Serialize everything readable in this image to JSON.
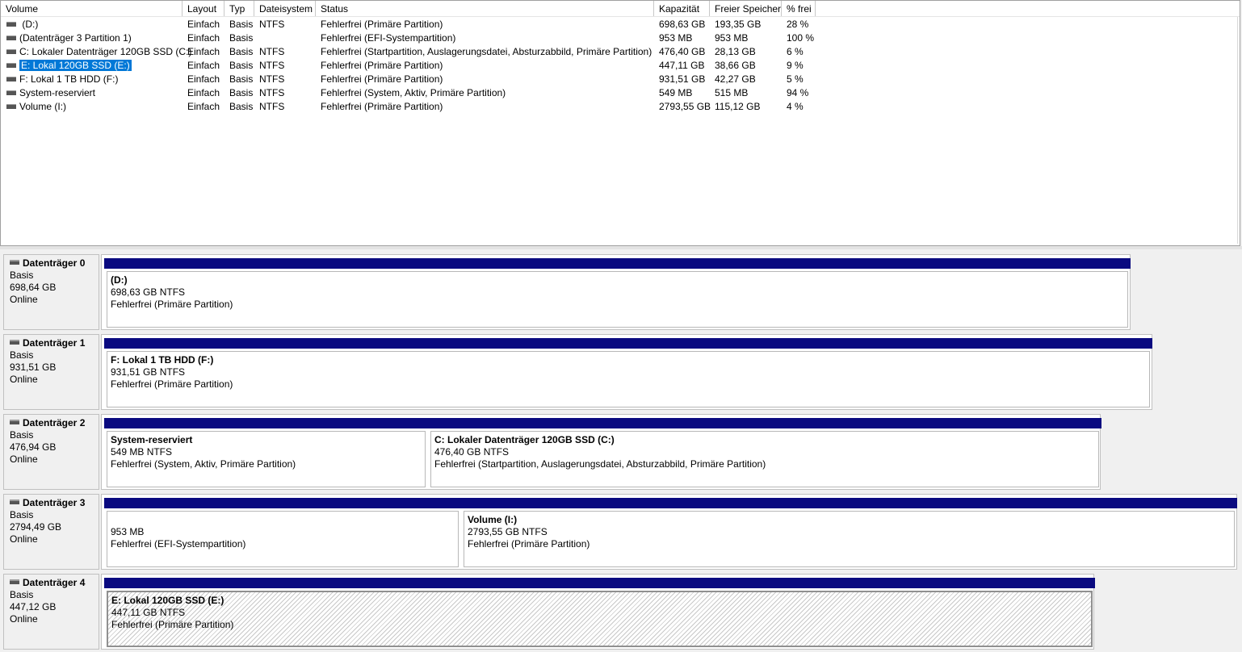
{
  "columns": [
    "Volume",
    "Layout",
    "Typ",
    "Dateisystem",
    "Status",
    "Kapazität",
    "Freier Speicher",
    "% frei"
  ],
  "volumes": [
    {
      "name": " (D:)",
      "layout": "Einfach",
      "typ": "Basis",
      "fs": "NTFS",
      "status": "Fehlerfrei (Primäre Partition)",
      "kap": "698,63 GB",
      "frei": "193,35 GB",
      "pct": "28 %"
    },
    {
      "name": "(Datenträger 3 Partition 1)",
      "layout": "Einfach",
      "typ": "Basis",
      "fs": "",
      "status": "Fehlerfrei (EFI-Systempartition)",
      "kap": "953 MB",
      "frei": "953 MB",
      "pct": "100 %"
    },
    {
      "name": "C: Lokaler Datenträger 120GB SSD (C:)",
      "layout": "Einfach",
      "typ": "Basis",
      "fs": "NTFS",
      "status": "Fehlerfrei (Startpartition, Auslagerungsdatei, Absturzabbild, Primäre Partition)",
      "kap": "476,40 GB",
      "frei": "28,13 GB",
      "pct": "6 %"
    },
    {
      "name": "E: Lokal 120GB SSD (E:)",
      "layout": "Einfach",
      "typ": "Basis",
      "fs": "NTFS",
      "status": "Fehlerfrei (Primäre Partition)",
      "kap": "447,11 GB",
      "frei": "38,66 GB",
      "pct": "9 %"
    },
    {
      "name": "F: Lokal 1 TB HDD (F:)",
      "layout": "Einfach",
      "typ": "Basis",
      "fs": "NTFS",
      "status": "Fehlerfrei (Primäre Partition)",
      "kap": "931,51 GB",
      "frei": "42,27 GB",
      "pct": "5 %"
    },
    {
      "name": "System-reserviert",
      "layout": "Einfach",
      "typ": "Basis",
      "fs": "NTFS",
      "status": "Fehlerfrei (System, Aktiv, Primäre Partition)",
      "kap": "549 MB",
      "frei": "515 MB",
      "pct": "94 %"
    },
    {
      "name": "Volume (I:)",
      "layout": "Einfach",
      "typ": "Basis",
      "fs": "NTFS",
      "status": "Fehlerfrei (Primäre Partition)",
      "kap": "2793,55 GB",
      "frei": "115,12 GB",
      "pct": "4 %"
    }
  ],
  "selected_volume_index": 3,
  "disks": [
    {
      "name": "Datenträger 0",
      "type": "Basis",
      "size": "698,64 GB",
      "state": "Online",
      "partitions": [
        {
          "title": " (D:)",
          "size": "698,63 GB NTFS",
          "status": "Fehlerfrei (Primäre Partition)"
        }
      ]
    },
    {
      "name": "Datenträger 1",
      "type": "Basis",
      "size": "931,51 GB",
      "state": "Online",
      "partitions": [
        {
          "title": "F: Lokal 1 TB HDD  (F:)",
          "size": "931,51 GB NTFS",
          "status": "Fehlerfrei (Primäre Partition)"
        }
      ]
    },
    {
      "name": "Datenträger 2",
      "type": "Basis",
      "size": "476,94 GB",
      "state": "Online",
      "partitions": [
        {
          "title": "System-reserviert",
          "size": "549 MB NTFS",
          "status": "Fehlerfrei (System, Aktiv, Primäre Partition)"
        },
        {
          "title": "C: Lokaler Datenträger 120GB SSD  (C:)",
          "size": "476,40 GB NTFS",
          "status": "Fehlerfrei (Startpartition, Auslagerungsdatei, Absturzabbild, Primäre Partition)"
        }
      ]
    },
    {
      "name": "Datenträger 3",
      "type": "Basis",
      "size": "2794,49 GB",
      "state": "Online",
      "partitions": [
        {
          "title": "",
          "size": "953 MB",
          "status": "Fehlerfrei (EFI-Systempartition)"
        },
        {
          "title": "Volume  (I:)",
          "size": "2793,55 GB NTFS",
          "status": "Fehlerfrei (Primäre Partition)"
        }
      ]
    },
    {
      "name": "Datenträger 4",
      "type": "Basis",
      "size": "447,12 GB",
      "state": "Online",
      "partitions": [
        {
          "title": "E: Lokal 120GB SSD  (E:)",
          "size": "447,11 GB NTFS",
          "status": "Fehlerfrei (Primäre Partition)"
        }
      ]
    }
  ],
  "colors": {
    "partition_bar": "#0a0a80",
    "selection": "#0078d7"
  }
}
